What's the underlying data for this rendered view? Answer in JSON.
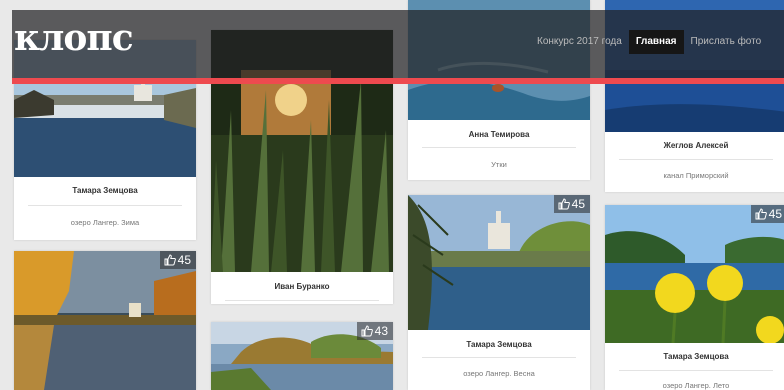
{
  "site": {
    "logo": "клопс"
  },
  "nav": {
    "items": [
      {
        "label": "Конкурс 2017 года",
        "active": false
      },
      {
        "label": "Главная",
        "active": true
      },
      {
        "label": "Прислать фото",
        "active": false
      }
    ]
  },
  "colors": {
    "accent": "#ee4a4f",
    "header_bg": "#232326",
    "background": "#e9e9e9"
  },
  "cards": [
    {
      "author": "Тамара Земцова",
      "caption": "озеро Лангер. Зима",
      "likes": ""
    },
    {
      "author": "",
      "caption": "",
      "likes": "45"
    },
    {
      "author": "Иван Буранко",
      "caption": "",
      "likes": ""
    },
    {
      "author": "",
      "caption": "",
      "likes": "43"
    },
    {
      "author": "Анна Темирова",
      "caption": "Утки",
      "likes": ""
    },
    {
      "author": "Тамара Земцова",
      "caption": "озеро Лангер. Весна",
      "likes": "45"
    },
    {
      "author": "Жеглов Алексей",
      "caption": "канал Приморский",
      "likes": ""
    },
    {
      "author": "Тамара Земцова",
      "caption": "озеро Лангер. Лето",
      "likes": "45"
    }
  ]
}
